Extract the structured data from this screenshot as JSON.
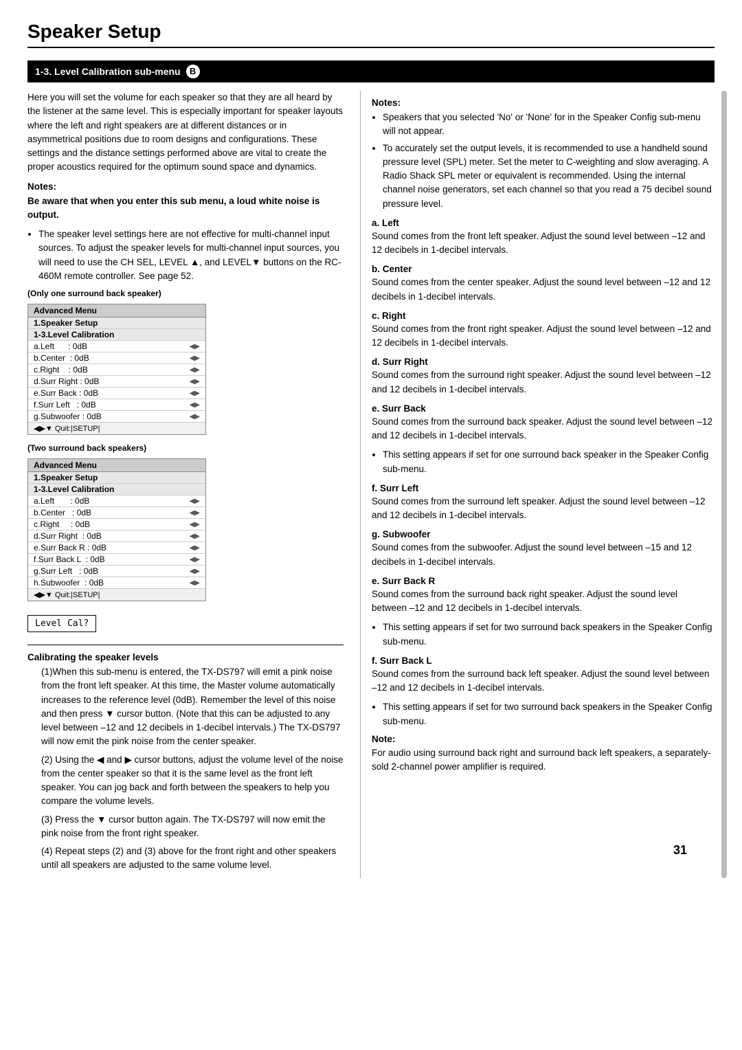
{
  "page": {
    "title": "Speaker Setup",
    "number": "31"
  },
  "section": {
    "header": "1-3. Level Calibration sub-menu",
    "badge": "B"
  },
  "intro_text": "Here you will set the volume for each speaker so that they are all heard by the listener at the same level. This is especially important for speaker layouts where the left and right speakers are at different distances or in asymmetrical positions due to room designs and configurations. These settings and the distance settings performed above are vital to create the proper acoustics required for the optimum sound space and dynamics.",
  "notes_left": {
    "header": "Notes:",
    "bold_note": "Be aware that when you enter this sub menu, a loud white noise is output.",
    "bullets": [
      "The speaker level settings here are not effective for multi-channel input sources. To adjust the speaker levels for multi-channel input sources, you will need to use the CH SEL, LEVEL ▲, and LEVEL▼ buttons on the RC-460M remote controller. See page 52."
    ]
  },
  "menu_one_surround": {
    "label": "(Only one surround back speaker)",
    "title": "Advanced Menu",
    "items": [
      {
        "label": "1.Speaker Setup",
        "type": "header"
      },
      {
        "label": "1-3.Level Calibration",
        "type": "sub-header"
      },
      {
        "label": "a.Left      : 0dB",
        "icon": "◀▶"
      },
      {
        "label": "b.Center   : 0dB",
        "icon": "◀▶"
      },
      {
        "label": "c.Right     : 0dB",
        "icon": "◀▶"
      },
      {
        "label": "d.Surr Right : 0dB",
        "icon": "◀▶"
      },
      {
        "label": "e.Surr Back : 0dB",
        "icon": "◀▶"
      },
      {
        "label": "f.Surr Left   : 0dB",
        "icon": "◀▶"
      },
      {
        "label": "g.Subwoofer  : 0dB",
        "icon": "◀▶"
      }
    ],
    "footer": "◀▶▼ Quit:|SETUP|"
  },
  "menu_two_surround": {
    "label": "(Two surround back speakers)",
    "title": "Advanced Menu",
    "items": [
      {
        "label": "1.Speaker Setup",
        "type": "header"
      },
      {
        "label": "1-3.Level Calibration",
        "type": "sub-header"
      },
      {
        "label": "a.Left       : 0dB",
        "icon": "◀▶"
      },
      {
        "label": "b.Center    : 0dB",
        "icon": "◀▶"
      },
      {
        "label": "c.Right      : 0dB",
        "icon": "◀▶"
      },
      {
        "label": "d.Surr Right  : 0dB",
        "icon": "◀▶"
      },
      {
        "label": "e.Surr Back R : 0dB",
        "icon": "◀▶"
      },
      {
        "label": "f.Surr Back L  : 0dB",
        "icon": "◀▶"
      },
      {
        "label": "g.Surr Left   : 0dB",
        "icon": "◀▶"
      },
      {
        "label": "h.Subwoofer  : 0dB",
        "icon": "◀▶"
      }
    ],
    "footer": "◀▶▼ Quit:|SETUP|"
  },
  "level_cal_label": "Level Cal?",
  "calibrating_header": "Calibrating the speaker levels",
  "calibration_steps": [
    "(1)When this sub-menu is entered, the TX-DS797 will emit a pink noise from the front left speaker. At this time, the Master volume automatically increases to the reference level (0dB). Remember the level of this noise and then press ▼ cursor button. (Note that this can be adjusted to any level between –12 and 12 decibels in 1-decibel intervals.) The TX-DS797 will now emit the pink noise from the center speaker.",
    "(2) Using the ◀ and ▶ cursor buttons, adjust the volume level of the noise from the center speaker so that it is the same level as the front left speaker. You can jog back and forth between the speakers to help you compare the volume levels.",
    "(3) Press the ▼ cursor button again. The TX-DS797 will now emit the pink noise from the front right speaker.",
    "(4) Repeat steps (2) and (3) above for the front right and other speakers until all speakers are adjusted to the same volume level."
  ],
  "right_col": {
    "notes_header": "Notes:",
    "notes_bullets": [
      "Speakers that you selected 'No' or 'None' for in the Speaker Config sub-menu will not appear.",
      "To accurately set the output levels, it is recommended to use a handheld sound pressure level (SPL) meter. Set the meter to C-weighting and slow averaging. A Radio Shack SPL meter or equivalent is recommended. Using the internal channel noise generators, set each channel so that you read a 75 decibel sound pressure level."
    ],
    "sections": [
      {
        "id": "a",
        "title": "a. Left",
        "text": "Sound comes from the front left speaker. Adjust the sound level between –12 and 12 decibels in 1-decibel intervals."
      },
      {
        "id": "b",
        "title": "b. Center",
        "text": "Sound comes from the center speaker. Adjust the sound level between –12 and 12 decibels in 1-decibel intervals."
      },
      {
        "id": "c",
        "title": "c. Right",
        "text": "Sound comes from the front right speaker. Adjust the sound level between –12 and 12 decibels in 1-decibel intervals."
      },
      {
        "id": "d",
        "title": "d. Surr Right",
        "text": "Sound comes from the surround right speaker. Adjust the sound level between –12 and 12 decibels in 1-decibel intervals."
      },
      {
        "id": "e",
        "title": "e. Surr Back",
        "text": "Sound comes from the surround back speaker. Adjust the sound level between –12 and 12 decibels in 1-decibel intervals.",
        "bullet": "This setting appears if set for one surround back speaker in the Speaker Config sub-menu."
      },
      {
        "id": "f",
        "title": "f. Surr Left",
        "text": "Sound comes from the surround left speaker. Adjust the sound level between –12 and 12 decibels in 1-decibel intervals."
      },
      {
        "id": "g",
        "title": "g. Subwoofer",
        "text": "Sound comes from the subwoofer. Adjust the sound level between –15 and 12 decibels in 1-decibel intervals."
      },
      {
        "id": "h",
        "title": "e. Surr Back R",
        "text": "Sound comes from the surround back right speaker. Adjust the sound level between –12 and 12 decibels in 1-decibel intervals.",
        "bullet": "This setting appears if set for two surround back speakers in the Speaker Config sub-menu."
      },
      {
        "id": "i",
        "title": "f. Surr Back L",
        "text": "Sound comes from the surround back left speaker. Adjust the sound level between –12 and 12 decibels in 1-decibel intervals.",
        "bullet": "This setting appears if set for two surround back speakers in the Speaker Config sub-menu."
      }
    ],
    "note_footer_header": "Note:",
    "note_footer_text": "For audio using surround back right and surround back left speakers, a separately-sold 2-channel power amplifier is required."
  }
}
